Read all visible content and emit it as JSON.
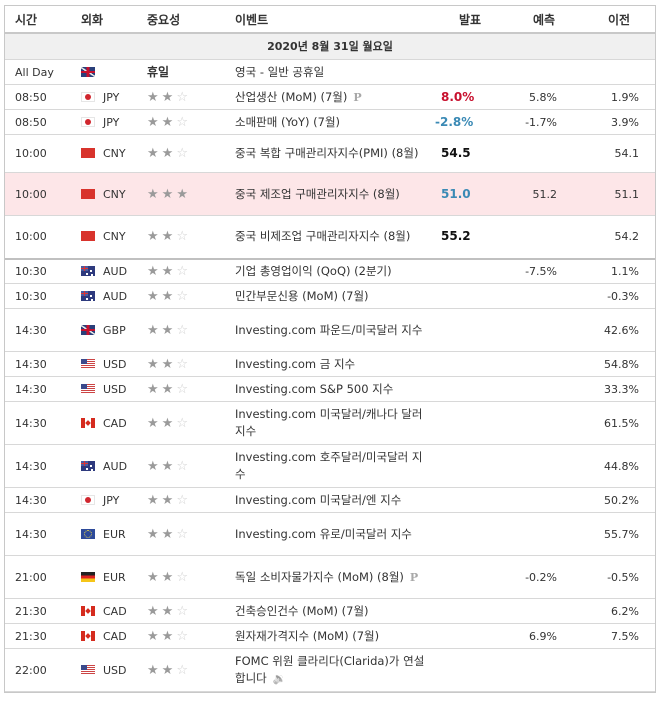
{
  "header": {
    "time": "시간",
    "currency": "외화",
    "importance": "중요성",
    "event": "이벤트",
    "actual": "발표",
    "forecast": "예측",
    "previous": "이전"
  },
  "date_label": "2020년 8월 31일 월요일",
  "colors": {
    "actual_up": "#c8102e",
    "actual_down": "#3b8ab5",
    "highlight_row": "#fde6e8",
    "date_row_bg": "#f0f0f0"
  },
  "rows": [
    {
      "time": "All Day",
      "flag": "gb-flag-icon",
      "currency": "",
      "importance": "휴일",
      "stars": null,
      "event": "영국 - 일반 공휴일",
      "actual": "",
      "actual_status": "",
      "forecast": "",
      "previous": "",
      "badge": ""
    },
    {
      "time": "08:50",
      "flag": "jp-flag-icon",
      "currency": "JPY",
      "stars": 2,
      "event": "산업생산 (MoM) (7월)",
      "actual": "8.0%",
      "actual_status": "up",
      "forecast": "5.8%",
      "previous": "1.9%",
      "badge": "preliminary-p-icon"
    },
    {
      "time": "08:50",
      "flag": "jp-flag-icon",
      "currency": "JPY",
      "stars": 2,
      "event": "소매판매 (YoY) (7월)",
      "actual": "-2.8%",
      "actual_status": "down",
      "forecast": "-1.7%",
      "previous": "3.9%",
      "badge": ""
    },
    {
      "time": "10:00",
      "flag": "cn-flag-icon",
      "currency": "CNY",
      "stars": 2,
      "event": "중국 복합 구매관리자지수(PMI) (8월)",
      "actual": "54.5",
      "actual_status": "neutral",
      "forecast": "",
      "previous": "54.1",
      "badge": ""
    },
    {
      "time": "10:00",
      "flag": "cn-flag-icon",
      "currency": "CNY",
      "stars": 3,
      "event": "중국 제조업 구매관리자지수 (8월)",
      "actual": "51.0",
      "actual_status": "down",
      "forecast": "51.2",
      "previous": "51.1",
      "badge": "",
      "highlight": true
    },
    {
      "time": "10:00",
      "flag": "cn-flag-icon",
      "currency": "CNY",
      "stars": 2,
      "event": "중국 비제조업 구매관리자지수 (8월)",
      "actual": "55.2",
      "actual_status": "neutral",
      "forecast": "",
      "previous": "54.2",
      "badge": ""
    },
    {
      "time": "10:30",
      "flag": "au-flag-icon",
      "currency": "AUD",
      "stars": 2,
      "event": "기업 총영업이익 (QoQ) (2분기)",
      "actual": "",
      "actual_status": "",
      "forecast": "-7.5%",
      "previous": "1.1%",
      "badge": ""
    },
    {
      "time": "10:30",
      "flag": "au-flag-icon",
      "currency": "AUD",
      "stars": 2,
      "event": "민간부문신용 (MoM) (7월)",
      "actual": "",
      "actual_status": "",
      "forecast": "",
      "previous": "-0.3%",
      "badge": ""
    },
    {
      "time": "14:30",
      "flag": "gb-flag-icon",
      "currency": "GBP",
      "stars": 2,
      "event": "Investing.com 파운드/미국달러 지수",
      "actual": "",
      "actual_status": "",
      "forecast": "",
      "previous": "42.6%",
      "badge": ""
    },
    {
      "time": "14:30",
      "flag": "us-flag-icon",
      "currency": "USD",
      "stars": 2,
      "event": "Investing.com 금 지수",
      "actual": "",
      "actual_status": "",
      "forecast": "",
      "previous": "54.8%",
      "badge": ""
    },
    {
      "time": "14:30",
      "flag": "us-flag-icon",
      "currency": "USD",
      "stars": 2,
      "event": "Investing.com S&P 500 지수",
      "actual": "",
      "actual_status": "",
      "forecast": "",
      "previous": "33.3%",
      "badge": ""
    },
    {
      "time": "14:30",
      "flag": "ca-flag-icon",
      "currency": "CAD",
      "stars": 2,
      "event": "Investing.com 미국달러/캐나다 달러 지수",
      "actual": "",
      "actual_status": "",
      "forecast": "",
      "previous": "61.5%",
      "badge": ""
    },
    {
      "time": "14:30",
      "flag": "au-flag-icon",
      "currency": "AUD",
      "stars": 2,
      "event": "Investing.com 호주달러/미국달러 지수",
      "actual": "",
      "actual_status": "",
      "forecast": "",
      "previous": "44.8%",
      "badge": ""
    },
    {
      "time": "14:30",
      "flag": "jp-flag-icon",
      "currency": "JPY",
      "stars": 2,
      "event": "Investing.com 미국달러/엔 지수",
      "actual": "",
      "actual_status": "",
      "forecast": "",
      "previous": "50.2%",
      "badge": ""
    },
    {
      "time": "14:30",
      "flag": "eu-flag-icon",
      "currency": "EUR",
      "stars": 2,
      "event": "Investing.com 유로/미국달러 지수",
      "actual": "",
      "actual_status": "",
      "forecast": "",
      "previous": "55.7%",
      "badge": ""
    },
    {
      "time": "21:00",
      "flag": "de-flag-icon",
      "currency": "EUR",
      "stars": 2,
      "event": "독일 소비자물가지수 (MoM) (8월)",
      "actual": "",
      "actual_status": "",
      "forecast": "-0.2%",
      "previous": "-0.5%",
      "badge": "preliminary-p-icon"
    },
    {
      "time": "21:30",
      "flag": "ca-flag-icon",
      "currency": "CAD",
      "stars": 2,
      "event": "건축승인건수 (MoM) (7월)",
      "actual": "",
      "actual_status": "",
      "forecast": "",
      "previous": "6.2%",
      "badge": ""
    },
    {
      "time": "21:30",
      "flag": "ca-flag-icon",
      "currency": "CAD",
      "stars": 2,
      "event": "원자재가격지수 (MoM) (7월)",
      "actual": "",
      "actual_status": "",
      "forecast": "6.9%",
      "previous": "7.5%",
      "badge": ""
    },
    {
      "time": "22:00",
      "flag": "us-flag-icon",
      "currency": "USD",
      "stars": 2,
      "event": "FOMC 위원 클라리다(Clarida)가 연설합니다",
      "actual": "",
      "actual_status": "",
      "forecast": "",
      "previous": "",
      "badge": "speech-speaker-icon"
    }
  ]
}
